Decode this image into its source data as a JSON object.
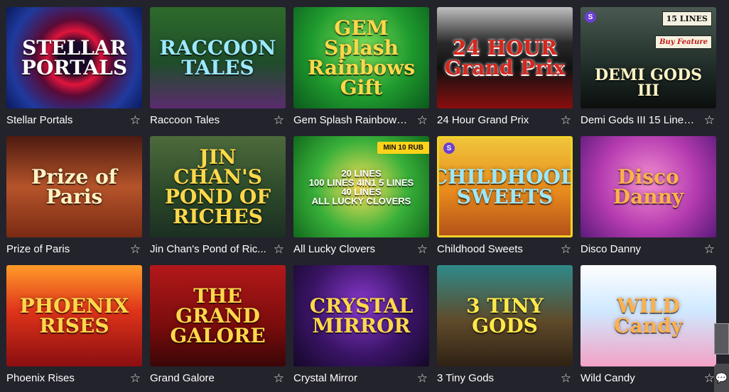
{
  "games": [
    {
      "label": "Stellar Portals",
      "art": "STELLAR\nPORTALS",
      "theme": "t1",
      "color": "c-white"
    },
    {
      "label": "Raccoon Tales",
      "art": "RACCOON\nTALES",
      "theme": "t2",
      "color": "c-cyan"
    },
    {
      "label": "Gem Splash Rainbows...",
      "art": "GEM\nSplash\nRainbows Gift",
      "theme": "t3",
      "color": "c-gold"
    },
    {
      "label": "24 Hour Grand Prix",
      "art": "24 HOUR\nGrand Prix",
      "theme": "t4",
      "color": "c-red"
    },
    {
      "label": "Demi Gods III 15 Lines ...",
      "art": "DEMI GODS III",
      "theme": "t5",
      "color": "c-cream",
      "badge_lines": "15 LINES",
      "badge_buy": "Buy Feature",
      "brand_mark": "S"
    },
    {
      "label": "Prize of Paris",
      "art": "Prize of\nParis",
      "theme": "t6",
      "color": "c-cream"
    },
    {
      "label": "Jin Chan's Pond of Ric...",
      "art": "JIN CHAN'S\nPOND OF RICHES",
      "theme": "t7",
      "color": "c-gold"
    },
    {
      "label": "All Lucky Clovers",
      "art": "20 LINES\n100 LINES  4IN1  5 LINES\n40 LINES\nALL LUCKY CLOVERS",
      "theme": "t8",
      "color": "c-white",
      "badge_min": "MIN 10 RUB"
    },
    {
      "label": "Childhood Sweets",
      "art": "CHILDHOOD\nSWEETS",
      "theme": "t9",
      "color": "c-cyan",
      "brand_mark": "S"
    },
    {
      "label": "Disco Danny",
      "art": "Disco\nDanny",
      "theme": "t10",
      "color": "c-pink"
    },
    {
      "label": "Phoenix Rises",
      "art": "PHOENIX\nRISES",
      "theme": "t11",
      "color": "c-gold"
    },
    {
      "label": "Grand Galore",
      "art": "THE GRAND\nGALORE",
      "theme": "t12",
      "color": "c-gold"
    },
    {
      "label": "Crystal Mirror",
      "art": "CRYSTAL\nMIRROR",
      "theme": "t13",
      "color": "c-gold"
    },
    {
      "label": "3 Tiny Gods",
      "art": "3 TINY\nGODS",
      "theme": "t14",
      "color": "c-yellow"
    },
    {
      "label": "Wild Candy",
      "art": "WILD\nCandy",
      "theme": "t15",
      "color": "c-pink"
    }
  ],
  "fav_icon": "star-outline-icon",
  "fav_glyph": "☆",
  "chat_glyph": "💬"
}
